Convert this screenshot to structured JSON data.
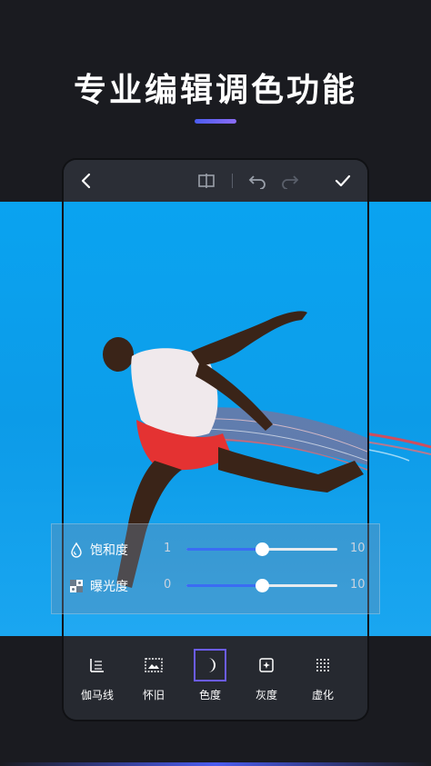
{
  "headline": {
    "title": "专业编辑调色功能"
  },
  "topbar": {
    "back_icon": "chevron-left-icon",
    "compare_icon": "split-compare-icon",
    "undo_icon": "undo-icon",
    "redo_icon": "redo-icon",
    "confirm_icon": "checkmark-icon"
  },
  "adjust_panel": {
    "rows": [
      {
        "label": "饱和度",
        "min": "1",
        "max": "10",
        "icon": "droplet-icon",
        "level": 0.5
      },
      {
        "label": "曝光度",
        "min": "0",
        "max": "10",
        "icon": "exposure-icon",
        "level": 0.5
      }
    ]
  },
  "toolbar": {
    "items": [
      {
        "label": "伽马线",
        "icon": "gamma-icon"
      },
      {
        "label": "怀旧",
        "icon": "vintage-photo-icon"
      },
      {
        "label": "色度",
        "icon": "moon-icon",
        "active": true
      },
      {
        "label": "灰度",
        "icon": "grayscale-icon"
      },
      {
        "label": "虚化",
        "icon": "blur-icon"
      }
    ]
  },
  "colors": {
    "accent": "#4b5cf0",
    "sky": "#0aa3f0",
    "slider_fill": "#3b6cf3"
  }
}
